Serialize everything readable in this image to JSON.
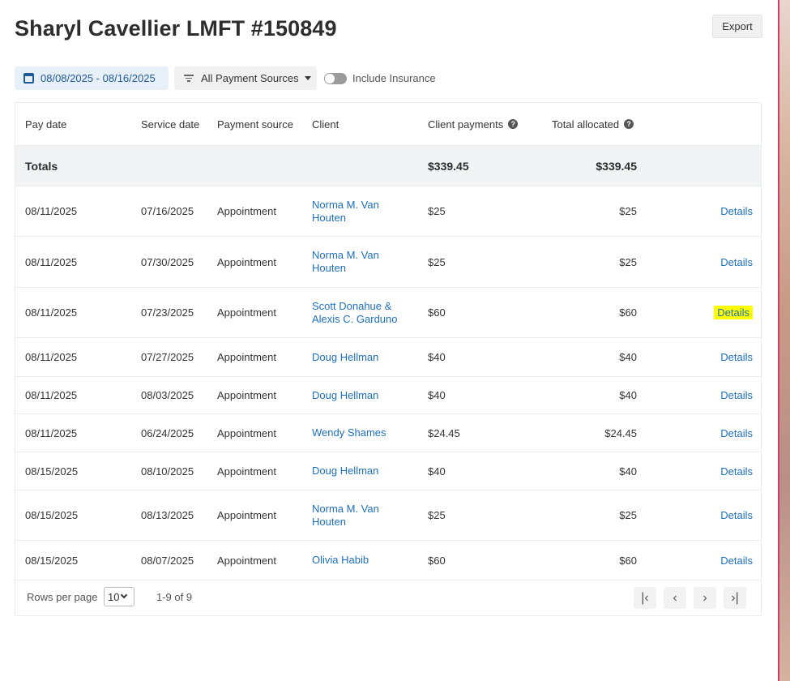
{
  "header": {
    "title": "Sharyl Cavellier LMFT #150849",
    "export_label": "Export"
  },
  "filters": {
    "date_range": "08/08/2025 - 08/16/2025",
    "payment_source": "All Payment Sources",
    "include_insurance_label": "Include Insurance",
    "include_insurance_on": false
  },
  "table": {
    "columns": {
      "pay_date": "Pay date",
      "service_date": "Service date",
      "payment_source": "Payment source",
      "client": "Client",
      "client_payments": "Client payments",
      "total_allocated": "Total allocated"
    },
    "totals": {
      "label": "Totals",
      "client_payments": "$339.45",
      "total_allocated": "$339.45"
    },
    "rows": [
      {
        "pay_date": "08/11/2025",
        "service_date": "07/16/2025",
        "source": "Appointment",
        "client_line1": "Norma M. Van",
        "client_line2": "Houten",
        "client_payments": "$25",
        "total_allocated": "$25",
        "action": "Details"
      },
      {
        "pay_date": "08/11/2025",
        "service_date": "07/30/2025",
        "source": "Appointment",
        "client_line1": "Norma M. Van",
        "client_line2": "Houten",
        "client_payments": "$25",
        "total_allocated": "$25",
        "action": "Details"
      },
      {
        "pay_date": "08/11/2025",
        "service_date": "07/23/2025",
        "source": "Appointment",
        "client_line1": "Scott Donahue &",
        "client_line2": "Alexis C. Garduno",
        "client_payments": "$60",
        "total_allocated": "$60",
        "action": "Details"
      },
      {
        "pay_date": "08/11/2025",
        "service_date": "07/27/2025",
        "source": "Appointment",
        "client_line1": "Doug Hellman",
        "client_line2": "",
        "client_payments": "$40",
        "total_allocated": "$40",
        "action": "Details"
      },
      {
        "pay_date": "08/11/2025",
        "service_date": "08/03/2025",
        "source": "Appointment",
        "client_line1": "Doug Hellman",
        "client_line2": "",
        "client_payments": "$40",
        "total_allocated": "$40",
        "action": "Details"
      },
      {
        "pay_date": "08/11/2025",
        "service_date": "06/24/2025",
        "source": "Appointment",
        "client_line1": "Wendy Shames",
        "client_line2": "",
        "client_payments": "$24.45",
        "total_allocated": "$24.45",
        "action": "Details"
      },
      {
        "pay_date": "08/15/2025",
        "service_date": "08/10/2025",
        "source": "Appointment",
        "client_line1": "Doug Hellman",
        "client_line2": "",
        "client_payments": "$40",
        "total_allocated": "$40",
        "action": "Details"
      },
      {
        "pay_date": "08/15/2025",
        "service_date": "08/13/2025",
        "source": "Appointment",
        "client_line1": "Norma M. Van",
        "client_line2": "Houten",
        "client_payments": "$25",
        "total_allocated": "$25",
        "action": "Details"
      },
      {
        "pay_date": "08/15/2025",
        "service_date": "08/07/2025",
        "source": "Appointment",
        "client_line1": "Olivia Habib",
        "client_line2": "",
        "client_payments": "$60",
        "total_allocated": "$60",
        "action": "Details"
      }
    ]
  },
  "pagination": {
    "rows_per_page_label": "Rows per page",
    "rows_per_page": "10",
    "range": "1-9 of 9",
    "first_icon": "first-page-icon",
    "prev_icon": "chevron-left-icon",
    "next_icon": "chevron-right-icon",
    "last_icon": "last-page-icon"
  },
  "colors": {
    "link": "#1e6fc0",
    "highlight": "#ffff00",
    "date_chip_bg": "#e7f0f9"
  }
}
